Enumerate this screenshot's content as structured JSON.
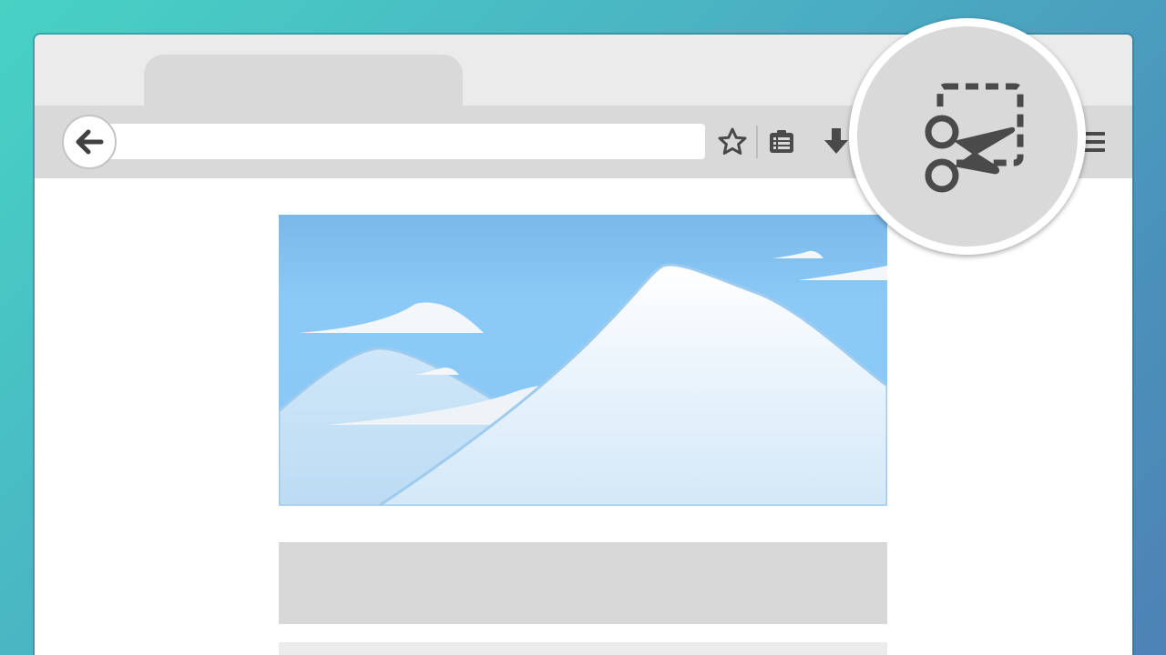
{
  "browser": {
    "tab": {
      "title": ""
    },
    "url_bar": {
      "value": ""
    },
    "toolbar": {
      "back_icon": "arrow-left-icon",
      "bookmark_icon": "star-icon",
      "reading_list_icon": "clipboard-list-icon",
      "download_icon": "download-arrow-icon",
      "menu_icon": "hamburger-menu-icon"
    }
  },
  "highlight": {
    "icon": "screenshot-scissors-icon"
  },
  "colors": {
    "accent_teal": "#47d2c4",
    "accent_blue": "#4d82b6",
    "chrome_gray": "#d9d9d9",
    "icon_dark": "#4a4a4a",
    "sky_blue": "#8ac8f4"
  }
}
